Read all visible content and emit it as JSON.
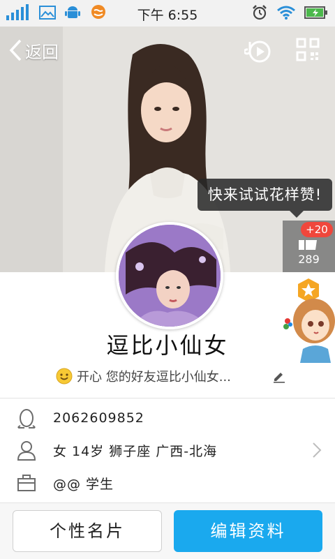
{
  "status_bar": {
    "time": "下午 6:55",
    "left_icons": [
      "signal-icon",
      "image-icon",
      "android-icon",
      "chat-icon"
    ],
    "right_icons": [
      "alarm-icon",
      "wifi-icon",
      "battery-icon"
    ]
  },
  "header": {
    "back_label": "返回",
    "music_icon": "music-play-icon",
    "qr_icon": "qr-code-icon"
  },
  "tooltip": {
    "text": "快来试试花样赞!"
  },
  "like": {
    "badge": "+20",
    "count": "289"
  },
  "profile": {
    "nickname": "逗比小仙女",
    "signature": "开心 您的好友逗比小仙女..."
  },
  "info": {
    "qq_number": "2062609852",
    "details": "女  14岁  狮子座  广西-北海",
    "occupation": "@@ 学生"
  },
  "buttons": {
    "card": "个性名片",
    "edit": "编辑资料"
  },
  "colors": {
    "primary": "#1aa9ee",
    "badge": "#f0473c",
    "tooltip_bg": "#282828"
  }
}
